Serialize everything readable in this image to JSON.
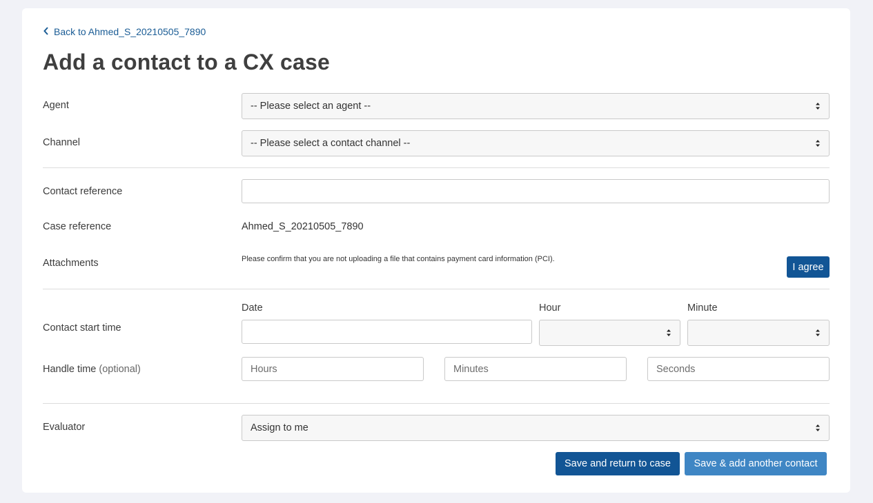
{
  "back_link": {
    "label": "Back to Ahmed_S_20210505_7890",
    "icon": "chevron-left-icon"
  },
  "page_title": "Add a contact to a CX case",
  "fields": {
    "agent": {
      "label": "Agent",
      "value": "-- Please select an agent --"
    },
    "channel": {
      "label": "Channel",
      "value": "-- Please select a contact channel --"
    },
    "contact_reference": {
      "label": "Contact reference",
      "value": ""
    },
    "case_reference": {
      "label": "Case reference",
      "value": "Ahmed_S_20210505_7890"
    },
    "attachments": {
      "label": "Attachments",
      "note": "Please confirm that you are not uploading a file that contains payment card information (PCI).",
      "agree_label": "I agree"
    },
    "contact_start_time": {
      "label": "Contact start time",
      "date_header": "Date",
      "hour_header": "Hour",
      "minute_header": "Minute",
      "date_value": "",
      "hour_value": "",
      "minute_value": ""
    },
    "handle_time": {
      "label": "Handle time",
      "optional": "(optional)",
      "hours_placeholder": "Hours",
      "minutes_placeholder": "Minutes",
      "seconds_placeholder": "Seconds"
    },
    "evaluator": {
      "label": "Evaluator",
      "value": "Assign to me"
    }
  },
  "actions": {
    "save_return": "Save and return to case",
    "save_add": "Save & add another contact"
  },
  "colors": {
    "page_bg": "#f1f2f7",
    "primary": "#125595",
    "secondary": "#3f86c4",
    "link": "#1a5c95"
  }
}
